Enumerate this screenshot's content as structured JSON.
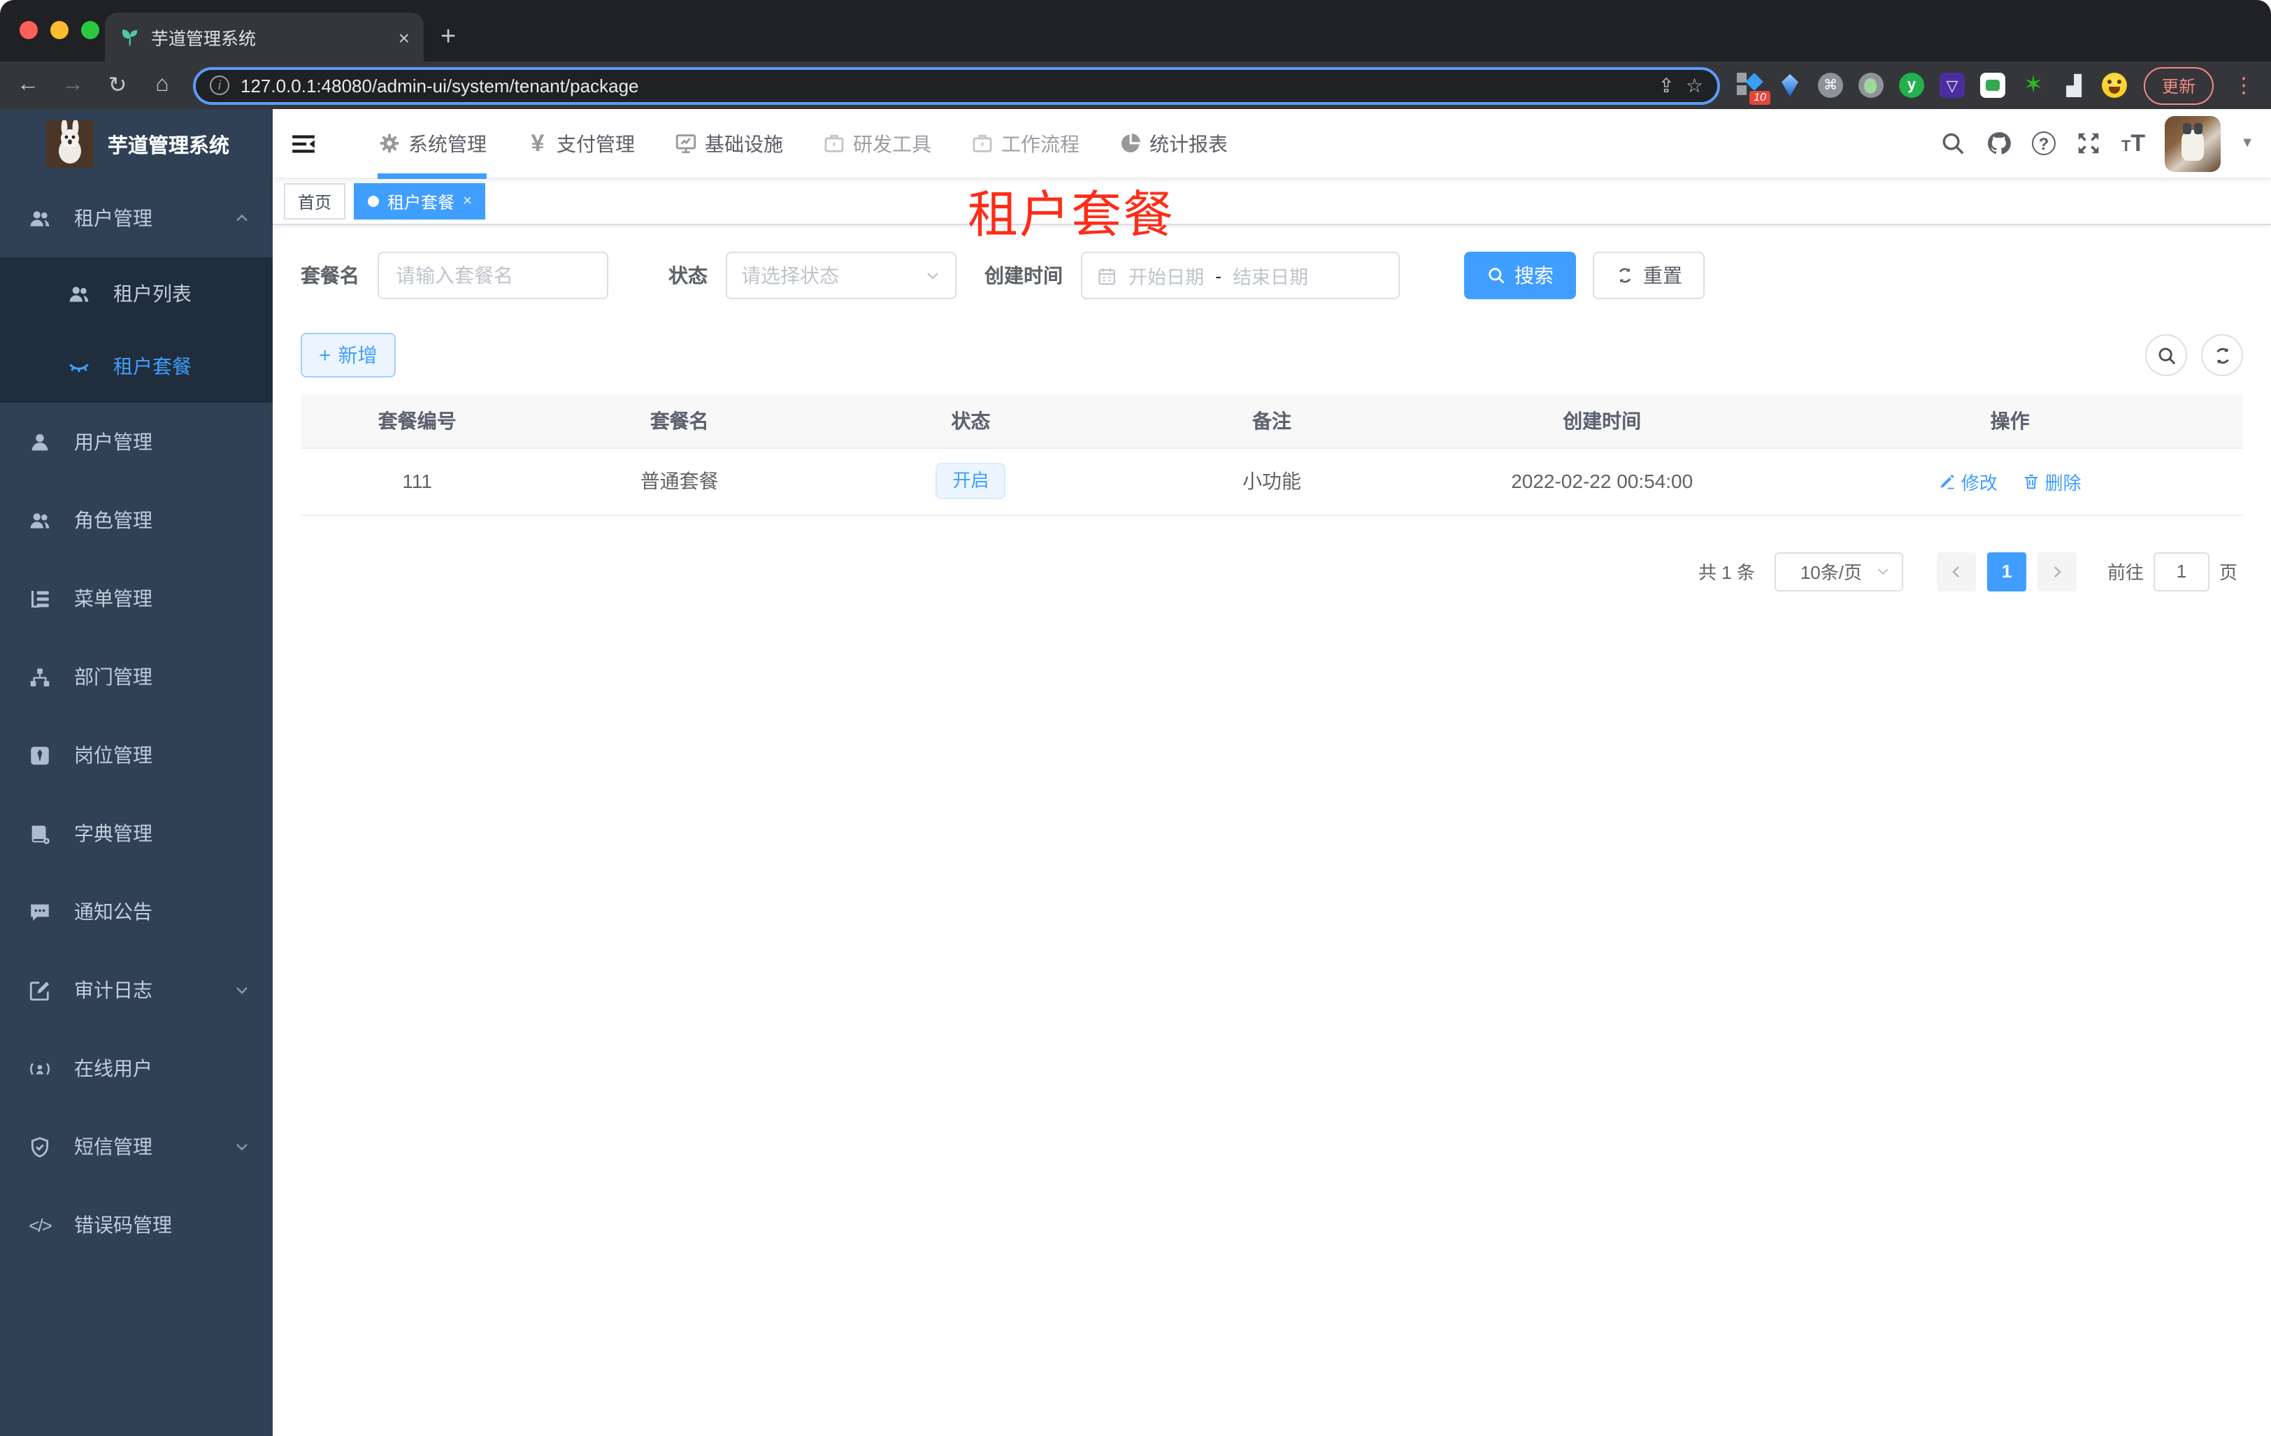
{
  "browser": {
    "tab_title": "芋道管理系统",
    "url": "127.0.0.1:48080/admin-ui/system/tenant/package",
    "update_label": "更新",
    "extension_badge": "10",
    "glyphs": {
      "close": "×",
      "new_tab": "+",
      "back": "←",
      "forward": "→",
      "reload": "↻",
      "home": "⌂",
      "star": "☆",
      "kebab": "⋮",
      "command": "⌘",
      "share": "⇪",
      "info": "i",
      "ext_y": "y",
      "ext_star": "✶",
      "ext_puzzle": "▟",
      "ext_shield": "▽"
    }
  },
  "sidebar": {
    "app_title": "芋道管理系统",
    "items": {
      "tenant": "租户管理",
      "tenant_list": "租户列表",
      "tenant_package": "租户套餐",
      "user": "用户管理",
      "role": "角色管理",
      "menu": "菜单管理",
      "dept": "部门管理",
      "post": "岗位管理",
      "dict": "字典管理",
      "notice": "通知公告",
      "audit": "审计日志",
      "online": "在线用户",
      "sms": "短信管理",
      "errcode": "错误码管理"
    },
    "code_glyph": "</>"
  },
  "navbar": {
    "menus": [
      "系统管理",
      "支付管理",
      "基础设施",
      "研发工具",
      "工作流程",
      "统计报表"
    ],
    "yen_glyph": "¥",
    "help_glyph": "?",
    "font_size_glyph": "T"
  },
  "tags": {
    "home": "首页",
    "active": "租户套餐"
  },
  "heading": "租户套餐",
  "filters": {
    "name_label": "套餐名",
    "name_placeholder": "请输入套餐名",
    "status_label": "状态",
    "status_placeholder": "请选择状态",
    "date_label": "创建时间",
    "date_start_placeholder": "开始日期",
    "date_separator": "-",
    "date_end_placeholder": "结束日期",
    "search_label": "搜索",
    "reset_label": "重置"
  },
  "toolbar": {
    "add_label": "新增"
  },
  "table": {
    "columns": [
      "套餐编号",
      "套餐名",
      "状态",
      "备注",
      "创建时间",
      "操作"
    ],
    "row": {
      "id": "111",
      "name": "普通套餐",
      "status": "开启",
      "remark": "小功能",
      "created": "2022-02-22 00:54:00",
      "edit_label": "修改",
      "delete_label": "删除"
    }
  },
  "pagination": {
    "total": "共 1 条",
    "page_size": "10条/页",
    "current_page": "1",
    "goto_label": "前往",
    "goto_value": "1",
    "unit_label": "页"
  },
  "colors": {
    "primary": "#409eff",
    "sidebar_bg": "#304156",
    "sidebar_submenu_bg": "#1f2d3d",
    "heading_red": "#fe2c19",
    "tag_status_bg": "#ecf5ff",
    "chrome_dark": "#202124"
  }
}
